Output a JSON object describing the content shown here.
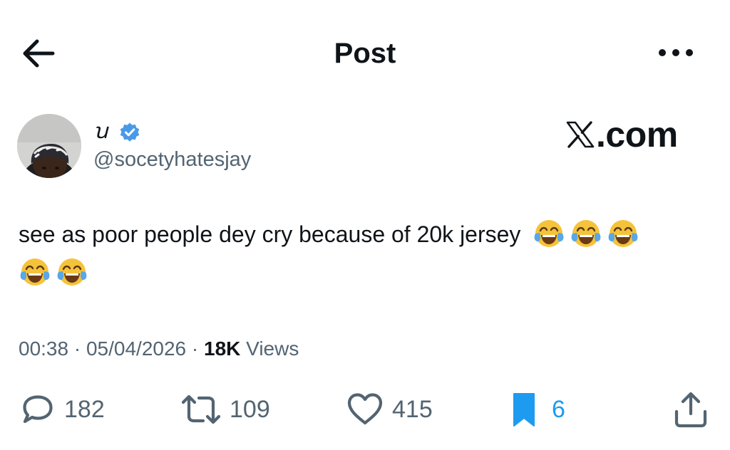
{
  "header": {
    "title": "Post",
    "back_icon": "arrow-left-icon",
    "more_icon": "more-horizontal-icon"
  },
  "author": {
    "display_name": "ꭒ",
    "handle": "@socetyhatesjay",
    "verified": true,
    "verified_color": "#4a99e9"
  },
  "brand": {
    "text": ".com",
    "logo_icon": "x-logo-icon"
  },
  "post": {
    "text": "see as poor people dey cry because of 20k jersey",
    "emoji": [
      "😂",
      "😂",
      "😂",
      "😂",
      "😂"
    ],
    "emoji_icon": "face-with-tears-of-joy-icon"
  },
  "meta": {
    "time": "00:38",
    "separator": "·",
    "date": "05/04/2026",
    "views_count": "18K",
    "views_label": "Views"
  },
  "actions": {
    "replies": "182",
    "reposts": "109",
    "likes": "415",
    "bookmarks": "6",
    "bookmark_color": "#1d9bf0"
  }
}
